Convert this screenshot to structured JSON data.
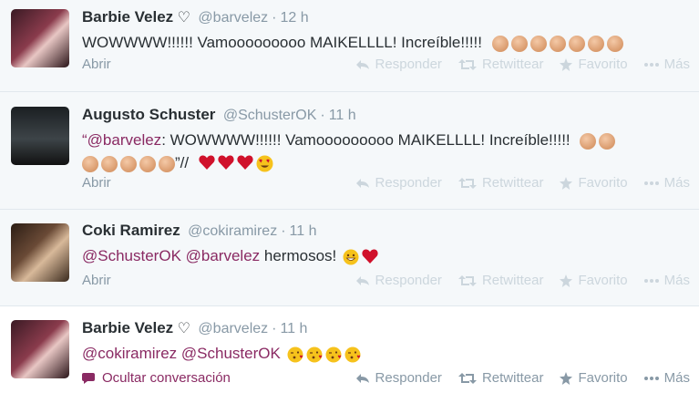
{
  "tweets": [
    {
      "fullname": "Barbie Velez",
      "heart": "♡",
      "username": "@barvelez",
      "time": "12 h",
      "text": "WOWWWW!!!!!! Vamooooooooo MAIKELLLL! Increíble!!!!!",
      "link": "Abrir",
      "actions": {
        "reply": "Responder",
        "retweet": "Retwittear",
        "favorite": "Favorito",
        "more": "Más"
      }
    },
    {
      "fullname": "Augusto Schuster",
      "username": "@SchusterOK",
      "time": "11 h",
      "quote_open": "“",
      "mention": "@barvelez",
      "text": ": WOWWWW!!!!!! Vamooooooooo MAIKELLLL! Increíble!!!!!",
      "quote_close": "”//",
      "link": "Abrir",
      "actions": {
        "reply": "Responder",
        "retweet": "Retwittear",
        "favorite": "Favorito",
        "more": "Más"
      }
    },
    {
      "fullname": "Coki Ramirez",
      "username": "@cokiramirez",
      "time": "11 h",
      "mention1": "@SchusterOK",
      "mention2": "@barvelez",
      "text": " hermosos!",
      "link": "Abrir",
      "actions": {
        "reply": "Responder",
        "retweet": "Retwittear",
        "favorite": "Favorito",
        "more": "Más"
      }
    },
    {
      "fullname": "Barbie Velez",
      "heart": "♡",
      "username": "@barvelez",
      "time": "11 h",
      "mention1": "@cokiramirez",
      "mention2": "@SchusterOK",
      "link": "Ocultar conversación",
      "actions": {
        "reply": "Responder",
        "retweet": "Retwittear",
        "favorite": "Favorito",
        "more": "Más"
      }
    }
  ],
  "colors": {
    "link_accent": "#8a2a63",
    "muted_bg": "#f5f8fa",
    "muted_text": "#8899a6"
  },
  "icons": [
    "clapping-hands-emoji",
    "red-heart-emoji",
    "heart-eyes-emoji",
    "grinning-face-emoji",
    "kiss-face-emoji",
    "reply-icon",
    "retweet-icon",
    "star-icon",
    "more-dots-icon",
    "speech-bubble-icon"
  ]
}
